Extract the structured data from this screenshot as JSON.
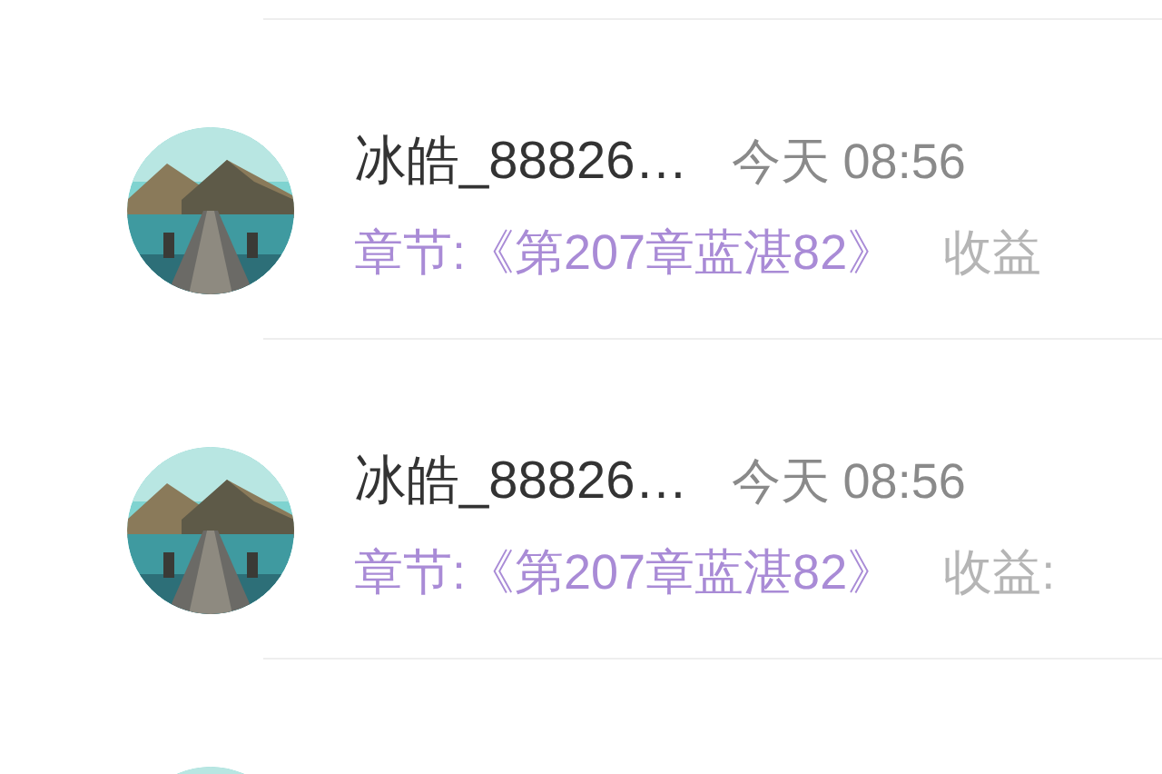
{
  "items": [
    {
      "kind": "entry",
      "name": "冰皓_88826…",
      "time": "今天 08:56",
      "chapter": "章节:《第207章蓝湛82》",
      "income": "收益"
    },
    {
      "kind": "entry",
      "name": "冰皓_88826…",
      "time": "今天 08:56",
      "chapter": "章节:《第207章蓝湛82》",
      "income": "收益:"
    },
    {
      "kind": "partial"
    }
  ]
}
